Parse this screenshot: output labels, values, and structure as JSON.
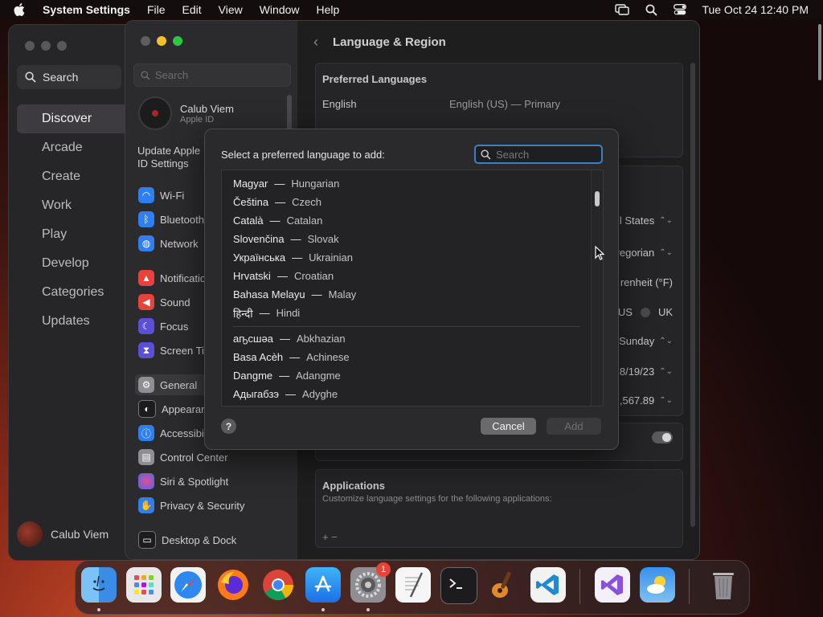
{
  "menubar": {
    "app_name": "System Settings",
    "menus": [
      "File",
      "Edit",
      "View",
      "Window",
      "Help"
    ],
    "clock": "Tue Oct 24  12:40 PM",
    "icons": [
      "screen-mirroring-icon",
      "spotlight-search-icon",
      "control-center-icon"
    ]
  },
  "appstore": {
    "search_label": "Search",
    "nav": [
      "Discover",
      "Arcade",
      "Create",
      "Work",
      "Play",
      "Develop",
      "Categories",
      "Updates"
    ],
    "active": "Discover",
    "user_name": "Calub Viem"
  },
  "settings": {
    "search_placeholder": "Search",
    "account_name": "Calub Viem",
    "account_sub": "Apple ID",
    "update_text": "Update Apple ID Settings",
    "items": [
      {
        "label": "Wi-Fi",
        "icon": "wifi-icon",
        "color": "#2f7ff0"
      },
      {
        "label": "Bluetooth",
        "icon": "bluetooth-icon",
        "color": "#2f7ff0"
      },
      {
        "label": "Network",
        "icon": "globe-icon",
        "color": "#2f7ff0"
      },
      {
        "label": "Notifications",
        "icon": "bell-icon",
        "color": "#e5443a"
      },
      {
        "label": "Sound",
        "icon": "speaker-icon",
        "color": "#e5443a"
      },
      {
        "label": "Focus",
        "icon": "moon-icon",
        "color": "#5b4fd6"
      },
      {
        "label": "Screen Time",
        "icon": "hourglass-icon",
        "color": "#5b4fd6"
      },
      {
        "label": "General",
        "icon": "gear-icon",
        "color": "#8e8e93"
      },
      {
        "label": "Appearance",
        "icon": "appearance-icon",
        "color": "#1c1c1e"
      },
      {
        "label": "Accessibility",
        "icon": "accessibility-icon",
        "color": "#2f7ff0"
      },
      {
        "label": "Control Center",
        "icon": "control-center-icon",
        "color": "#8e8e93"
      },
      {
        "label": "Siri & Spotlight",
        "icon": "siri-icon",
        "color": "#c04fd6"
      },
      {
        "label": "Privacy & Security",
        "icon": "hand-icon",
        "color": "#2f7ff0"
      },
      {
        "label": "Desktop & Dock",
        "icon": "dock-icon",
        "color": "#1c1c1e"
      }
    ],
    "active_item": "General",
    "header_title": "Language & Region",
    "preferred_languages_title": "Preferred Languages",
    "preferred_language": "English",
    "preferred_language_detail": "English (US) — Primary",
    "region_values": [
      {
        "text": "l States",
        "stepper": true
      },
      {
        "text": "regorian",
        "stepper": true
      },
      {
        "text": "renheit (°F)",
        "stepper": false
      },
      {
        "text": "US",
        "stepper": false
      },
      {
        "text": "UK",
        "stepper": false
      },
      {
        "text": "Sunday",
        "stepper": true
      },
      {
        "text": "8/19/23",
        "stepper": true
      },
      {
        "text": ",567.89",
        "stepper": true
      }
    ],
    "applications_title": "Applications",
    "applications_desc": "Customize language settings for the following applications:",
    "add_remove": "+  −"
  },
  "sheet": {
    "title": "Select a preferred language to add:",
    "search_placeholder": "Search",
    "languages_top": [
      {
        "native": "Magyar",
        "english": "Hungarian"
      },
      {
        "native": "Čeština",
        "english": "Czech"
      },
      {
        "native": "Català",
        "english": "Catalan"
      },
      {
        "native": "Slovenčina",
        "english": "Slovak"
      },
      {
        "native": "Українська",
        "english": "Ukrainian"
      },
      {
        "native": "Hrvatski",
        "english": "Croatian"
      },
      {
        "native": "Bahasa Melayu",
        "english": "Malay"
      },
      {
        "native": "हिन्दी",
        "english": "Hindi"
      }
    ],
    "languages_more": [
      {
        "native": "аҧсшәа",
        "english": "Abkhazian"
      },
      {
        "native": "Basa Acèh",
        "english": "Achinese"
      },
      {
        "native": "Dangme",
        "english": "Adangme"
      },
      {
        "native": "Адыгабзэ",
        "english": "Adyghe"
      }
    ],
    "dash": "—",
    "help_label": "?",
    "cancel_label": "Cancel",
    "add_label": "Add"
  },
  "dock": {
    "apps": [
      {
        "name": "Finder",
        "icon": "finder-icon",
        "running": true
      },
      {
        "name": "Launchpad",
        "icon": "launchpad-icon",
        "running": false
      },
      {
        "name": "Safari",
        "icon": "safari-icon",
        "running": false
      },
      {
        "name": "Firefox",
        "icon": "firefox-icon",
        "running": false
      },
      {
        "name": "Chrome",
        "icon": "chrome-icon",
        "running": false
      },
      {
        "name": "App Store",
        "icon": "app-store-icon",
        "running": true
      },
      {
        "name": "System Settings",
        "icon": "system-settings-icon",
        "running": true,
        "badge": "1"
      },
      {
        "name": "TextEdit",
        "icon": "textedit-icon",
        "running": false
      },
      {
        "name": "Terminal",
        "icon": "terminal-icon",
        "running": false
      },
      {
        "name": "GarageBand",
        "icon": "garageband-icon",
        "running": false
      },
      {
        "name": "Visual Studio Code",
        "icon": "vscode-icon",
        "running": false
      },
      {
        "name": "Visual Studio",
        "icon": "visual-studio-icon",
        "running": false
      },
      {
        "name": "Weather",
        "icon": "weather-icon",
        "running": false
      },
      {
        "name": "Trash",
        "icon": "trash-icon",
        "running": false
      }
    ]
  }
}
